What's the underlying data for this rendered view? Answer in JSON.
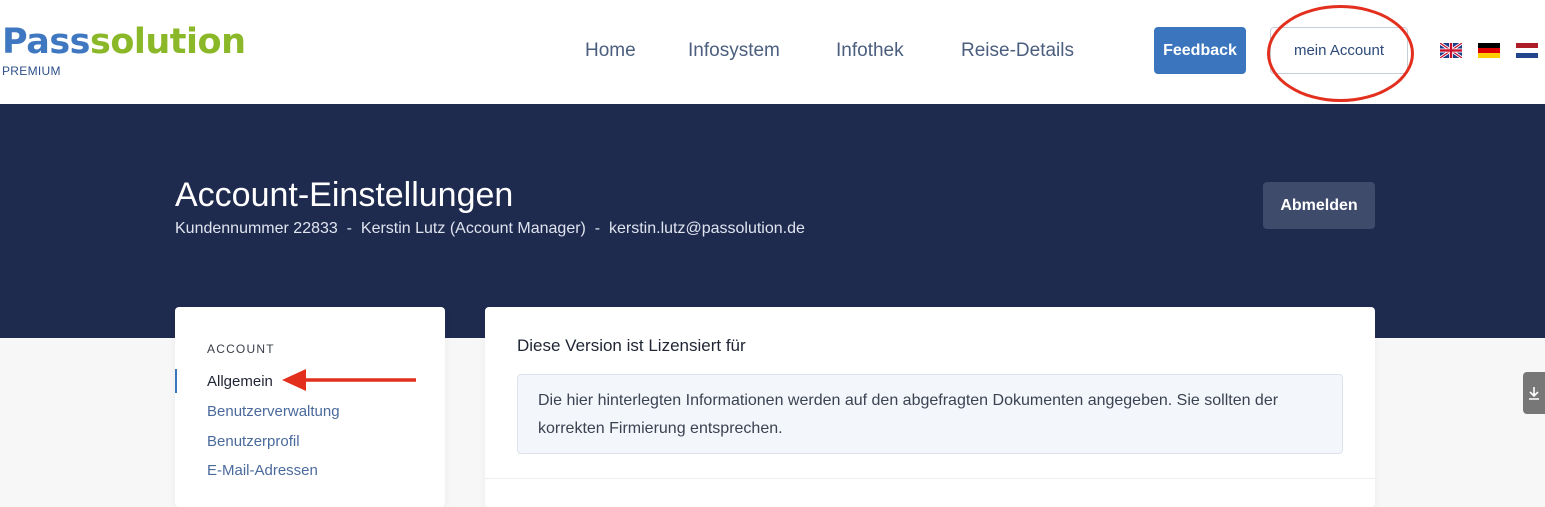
{
  "header": {
    "logo_part1": "Pass",
    "logo_part2": "olution",
    "logo_prefix_s": "s",
    "logo_sub": "PREMIUM",
    "nav": [
      "Home",
      "Infosystem",
      "Infothek",
      "Reise-Details"
    ],
    "feedback_label": "Feedback",
    "account_label": "mein Account",
    "flags": [
      "uk-flag-icon",
      "german-flag-icon",
      "dutch-flag-icon"
    ]
  },
  "hero": {
    "title": "Account-Einstellungen",
    "subtitle": "Kundennummer 22833  -  Kerstin Lutz (Account Manager)  -  kerstin.lutz@passolution.de",
    "logout_label": "Abmelden"
  },
  "sidebar": {
    "heading": "ACCOUNT",
    "items": [
      "Allgemein",
      "Benutzerverwaltung",
      "Benutzerprofil",
      "E-Mail-Adressen"
    ],
    "active_index": 0
  },
  "main": {
    "title": "Diese Version ist Lizensiert für",
    "info": "Die hier hinterlegten Informationen werden auf den abgefragten Dokumenten angegeben. Sie sollten der korrekten Firmierung entsprechen."
  },
  "colors": {
    "brand_blue": "#3f78c0",
    "brand_green": "#8ab828",
    "hero_bg": "#1f2a4f",
    "annotation_red": "#e3301e"
  },
  "side_tab_icon": "download-icon"
}
